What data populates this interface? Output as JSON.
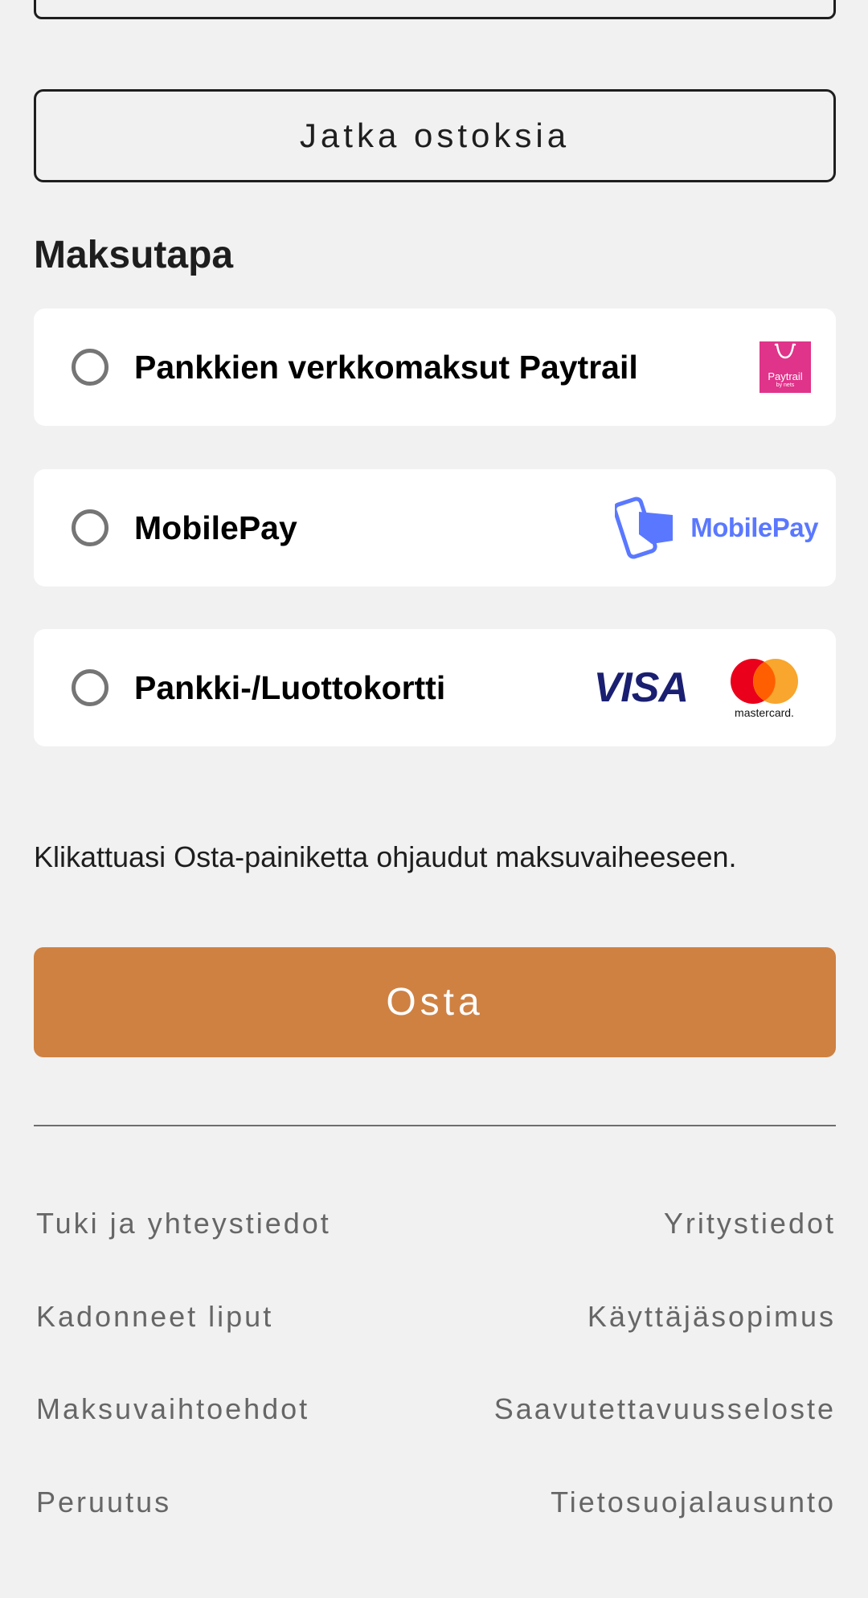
{
  "top": {
    "continue_label": "Jatka ostoksia"
  },
  "payment": {
    "title": "Maksutapa",
    "options": [
      {
        "label": "Pankkien verkkomaksut Paytrail",
        "logo_texts": [
          "Paytrail",
          "by nets"
        ]
      },
      {
        "label": "MobilePay",
        "logo_texts": [
          "MobilePay"
        ]
      },
      {
        "label": "Pankki-/Luottokortti",
        "logo_texts": [
          "VISA",
          "mastercard."
        ]
      }
    ],
    "info": "Klikattuasi Osta-painiketta ohjaudut maksuvaiheeseen.",
    "buy_label": "Osta"
  },
  "footer": {
    "left_links": [
      "Tuki ja yhteystiedot",
      "Kadonneet liput",
      "Maksuvaihtoehdot",
      "Peruutus"
    ],
    "right_links": [
      "Yritystiedot",
      "Käyttäjäsopimus",
      "Saavutettavuusseloste",
      "Tietosuojalausunto"
    ]
  },
  "colors": {
    "background": "#f1f1f1",
    "buy_button": "#cf8142",
    "paytrail_brand": "#e0338a",
    "mobilepay_brand": "#5a78ff",
    "visa_brand": "#1a1f71",
    "mastercard_red": "#eb001b",
    "mastercard_orange": "#f79e1b"
  }
}
